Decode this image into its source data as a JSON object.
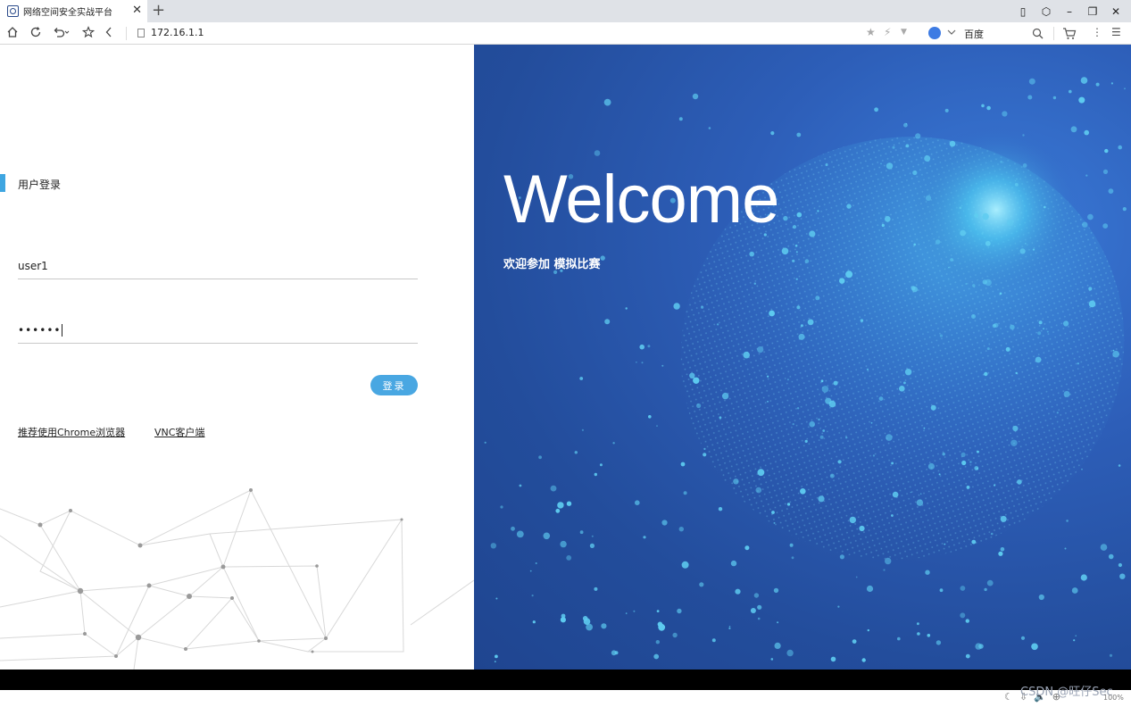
{
  "browser": {
    "tab_title": "网络空间安全实战平台",
    "tab_close": "✕",
    "new_tab": "+",
    "address": "172.16.1.1",
    "search_text": "百度",
    "window_controls": [
      "▯",
      "⬡",
      "–",
      "❐",
      "✕"
    ],
    "nav_icons": [
      "home-icon",
      "refresh-icon",
      "undo-icon",
      "star-icon",
      "back-icon"
    ]
  },
  "login": {
    "title": "用户登录",
    "username": "user1",
    "password_mask": "••••••",
    "submit_label": "登录",
    "link_chrome": "推荐使用Chrome浏览器",
    "link_vnc": "VNC客户端"
  },
  "hero": {
    "title": "Welcome",
    "subtitle": "欢迎参加 模拟比赛"
  },
  "status": {
    "watermark": "CSDN @旺仔Sec",
    "zoom": "100%"
  },
  "colors": {
    "accent": "#3fa6e1",
    "button": "#49a7e2",
    "hero_bg": "#2d5eb8",
    "particle": "#5ecbf0"
  }
}
